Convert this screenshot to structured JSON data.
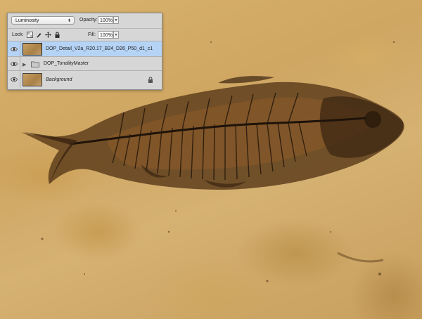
{
  "panel": {
    "blend_mode": "Luminosity",
    "opacity_label": "Opacity:",
    "opacity_value": "100%",
    "lock_label": "Lock:",
    "fill_label": "Fill:",
    "fill_value": "100%"
  },
  "layers": [
    {
      "name": "DOP_Detail_V2a_R20.17_B24_D26_P50_d1_c1",
      "selected": true,
      "type": "smart-object"
    },
    {
      "name": "DOP_TonalityMaster",
      "selected": false,
      "type": "group"
    },
    {
      "name": "Background",
      "selected": false,
      "type": "background",
      "locked": true
    }
  ],
  "colors": {
    "selection": "#b5d3f5",
    "panel_bg": "#d6d6d6",
    "stone": "#d2ab68"
  }
}
